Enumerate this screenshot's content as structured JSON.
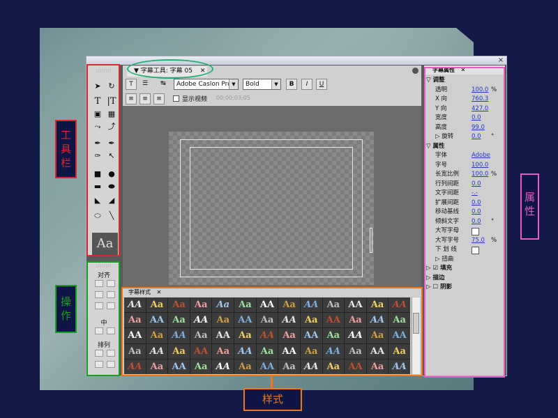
{
  "window": {
    "close": "×"
  },
  "toolbar": {
    "grip": "∷∷∷∷",
    "preview": "Aa"
  },
  "actions": {
    "grip": "∷∷∷∷",
    "align_label": "对齐",
    "center_label": "中",
    "distribute_label": "排列"
  },
  "title_panel": {
    "tab_label": "▼ 字幕工具: 字幕 05",
    "tab_close": "✕",
    "font_family": "Adobe Caslon Pro",
    "font_style": "Bold",
    "bold_btn": "B",
    "italic_btn": "I",
    "underline_btn": "U",
    "show_video_label": "显示视频",
    "timecode": "00;00;03;05"
  },
  "styles_panel": {
    "tab_label": "字幕样式",
    "tab_close": "✕",
    "swatches": [
      "AA",
      "Aa",
      "Aa",
      "Aa",
      "Aa",
      "Aa",
      "AA",
      "Aa",
      "AA",
      "Aa",
      "AA",
      "Aa",
      "AA"
    ]
  },
  "properties": {
    "tab_label": "字幕属性",
    "tab_close": "✕",
    "rows": [
      {
        "type": "section",
        "label": "▽ 调整"
      },
      {
        "type": "row",
        "label": "透明",
        "value": "100.0",
        "unit": "%"
      },
      {
        "type": "row",
        "label": "X 向",
        "value": "760.3",
        "unit": ""
      },
      {
        "type": "row",
        "label": "Y 向",
        "value": "427.0",
        "unit": ""
      },
      {
        "type": "row",
        "label": "宽度",
        "value": "0.0",
        "unit": ""
      },
      {
        "type": "row",
        "label": "高度",
        "value": "99.0",
        "unit": ""
      },
      {
        "type": "row",
        "label": "▷ 旋转",
        "value": "0.0",
        "unit": "°"
      },
      {
        "type": "section",
        "label": "▽ 属性"
      },
      {
        "type": "row",
        "label": "字体",
        "value": "Adobe",
        "unit": ""
      },
      {
        "type": "row",
        "label": "字号",
        "value": "100.0",
        "unit": ""
      },
      {
        "type": "row",
        "label": "长宽比例",
        "value": "100.0",
        "unit": "%"
      },
      {
        "type": "row",
        "label": "行列间距",
        "value": "0.0",
        "unit": ""
      },
      {
        "type": "row",
        "label": "文字间距",
        "value": "-.-",
        "unit": ""
      },
      {
        "type": "row",
        "label": "扩展间距",
        "value": "0.0",
        "unit": ""
      },
      {
        "type": "row",
        "label": "移动基线",
        "value": "0.0",
        "unit": ""
      },
      {
        "type": "row",
        "label": "倾斜文字",
        "value": "0.0",
        "unit": "°"
      },
      {
        "type": "check",
        "label": "大写字母"
      },
      {
        "type": "row",
        "label": "大写字号",
        "value": "75.0",
        "unit": "%"
      },
      {
        "type": "check",
        "label": "下 划 线"
      },
      {
        "type": "row",
        "label": "▷ 扭曲",
        "value": "",
        "unit": ""
      },
      {
        "type": "section",
        "label": "▷ ☑ 填充"
      },
      {
        "type": "section",
        "label": "▷ 描边"
      },
      {
        "type": "section",
        "label": "▷ ☐ 阴影"
      }
    ]
  },
  "annotations": {
    "toolbar": "工\n具\n栏",
    "actions": "操\n作",
    "styles": "样式",
    "properties": "属\n性",
    "colors": {
      "toolbar": "#e0242c",
      "actions": "#15a020",
      "styles": "#f07818",
      "properties": "#e65cc2",
      "title_ellipse": "#1fae74"
    }
  }
}
